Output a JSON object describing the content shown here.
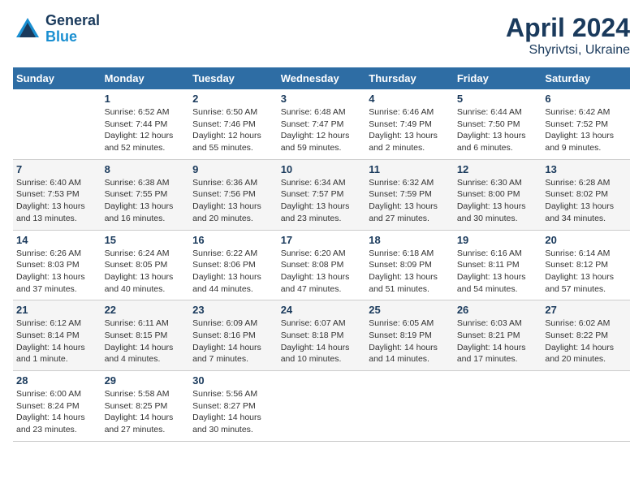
{
  "logo": {
    "name_part1": "General",
    "name_part2": "Blue"
  },
  "title": "April 2024",
  "subtitle": "Shyrivtsi, Ukraine",
  "header_days": [
    "Sunday",
    "Monday",
    "Tuesday",
    "Wednesday",
    "Thursday",
    "Friday",
    "Saturday"
  ],
  "weeks": [
    [
      {
        "day": "",
        "sunrise": "",
        "sunset": "",
        "daylight": ""
      },
      {
        "day": "1",
        "sunrise": "Sunrise: 6:52 AM",
        "sunset": "Sunset: 7:44 PM",
        "daylight": "Daylight: 12 hours and 52 minutes."
      },
      {
        "day": "2",
        "sunrise": "Sunrise: 6:50 AM",
        "sunset": "Sunset: 7:46 PM",
        "daylight": "Daylight: 12 hours and 55 minutes."
      },
      {
        "day": "3",
        "sunrise": "Sunrise: 6:48 AM",
        "sunset": "Sunset: 7:47 PM",
        "daylight": "Daylight: 12 hours and 59 minutes."
      },
      {
        "day": "4",
        "sunrise": "Sunrise: 6:46 AM",
        "sunset": "Sunset: 7:49 PM",
        "daylight": "Daylight: 13 hours and 2 minutes."
      },
      {
        "day": "5",
        "sunrise": "Sunrise: 6:44 AM",
        "sunset": "Sunset: 7:50 PM",
        "daylight": "Daylight: 13 hours and 6 minutes."
      },
      {
        "day": "6",
        "sunrise": "Sunrise: 6:42 AM",
        "sunset": "Sunset: 7:52 PM",
        "daylight": "Daylight: 13 hours and 9 minutes."
      }
    ],
    [
      {
        "day": "7",
        "sunrise": "Sunrise: 6:40 AM",
        "sunset": "Sunset: 7:53 PM",
        "daylight": "Daylight: 13 hours and 13 minutes."
      },
      {
        "day": "8",
        "sunrise": "Sunrise: 6:38 AM",
        "sunset": "Sunset: 7:55 PM",
        "daylight": "Daylight: 13 hours and 16 minutes."
      },
      {
        "day": "9",
        "sunrise": "Sunrise: 6:36 AM",
        "sunset": "Sunset: 7:56 PM",
        "daylight": "Daylight: 13 hours and 20 minutes."
      },
      {
        "day": "10",
        "sunrise": "Sunrise: 6:34 AM",
        "sunset": "Sunset: 7:57 PM",
        "daylight": "Daylight: 13 hours and 23 minutes."
      },
      {
        "day": "11",
        "sunrise": "Sunrise: 6:32 AM",
        "sunset": "Sunset: 7:59 PM",
        "daylight": "Daylight: 13 hours and 27 minutes."
      },
      {
        "day": "12",
        "sunrise": "Sunrise: 6:30 AM",
        "sunset": "Sunset: 8:00 PM",
        "daylight": "Daylight: 13 hours and 30 minutes."
      },
      {
        "day": "13",
        "sunrise": "Sunrise: 6:28 AM",
        "sunset": "Sunset: 8:02 PM",
        "daylight": "Daylight: 13 hours and 34 minutes."
      }
    ],
    [
      {
        "day": "14",
        "sunrise": "Sunrise: 6:26 AM",
        "sunset": "Sunset: 8:03 PM",
        "daylight": "Daylight: 13 hours and 37 minutes."
      },
      {
        "day": "15",
        "sunrise": "Sunrise: 6:24 AM",
        "sunset": "Sunset: 8:05 PM",
        "daylight": "Daylight: 13 hours and 40 minutes."
      },
      {
        "day": "16",
        "sunrise": "Sunrise: 6:22 AM",
        "sunset": "Sunset: 8:06 PM",
        "daylight": "Daylight: 13 hours and 44 minutes."
      },
      {
        "day": "17",
        "sunrise": "Sunrise: 6:20 AM",
        "sunset": "Sunset: 8:08 PM",
        "daylight": "Daylight: 13 hours and 47 minutes."
      },
      {
        "day": "18",
        "sunrise": "Sunrise: 6:18 AM",
        "sunset": "Sunset: 8:09 PM",
        "daylight": "Daylight: 13 hours and 51 minutes."
      },
      {
        "day": "19",
        "sunrise": "Sunrise: 6:16 AM",
        "sunset": "Sunset: 8:11 PM",
        "daylight": "Daylight: 13 hours and 54 minutes."
      },
      {
        "day": "20",
        "sunrise": "Sunrise: 6:14 AM",
        "sunset": "Sunset: 8:12 PM",
        "daylight": "Daylight: 13 hours and 57 minutes."
      }
    ],
    [
      {
        "day": "21",
        "sunrise": "Sunrise: 6:12 AM",
        "sunset": "Sunset: 8:14 PM",
        "daylight": "Daylight: 14 hours and 1 minute."
      },
      {
        "day": "22",
        "sunrise": "Sunrise: 6:11 AM",
        "sunset": "Sunset: 8:15 PM",
        "daylight": "Daylight: 14 hours and 4 minutes."
      },
      {
        "day": "23",
        "sunrise": "Sunrise: 6:09 AM",
        "sunset": "Sunset: 8:16 PM",
        "daylight": "Daylight: 14 hours and 7 minutes."
      },
      {
        "day": "24",
        "sunrise": "Sunrise: 6:07 AM",
        "sunset": "Sunset: 8:18 PM",
        "daylight": "Daylight: 14 hours and 10 minutes."
      },
      {
        "day": "25",
        "sunrise": "Sunrise: 6:05 AM",
        "sunset": "Sunset: 8:19 PM",
        "daylight": "Daylight: 14 hours and 14 minutes."
      },
      {
        "day": "26",
        "sunrise": "Sunrise: 6:03 AM",
        "sunset": "Sunset: 8:21 PM",
        "daylight": "Daylight: 14 hours and 17 minutes."
      },
      {
        "day": "27",
        "sunrise": "Sunrise: 6:02 AM",
        "sunset": "Sunset: 8:22 PM",
        "daylight": "Daylight: 14 hours and 20 minutes."
      }
    ],
    [
      {
        "day": "28",
        "sunrise": "Sunrise: 6:00 AM",
        "sunset": "Sunset: 8:24 PM",
        "daylight": "Daylight: 14 hours and 23 minutes."
      },
      {
        "day": "29",
        "sunrise": "Sunrise: 5:58 AM",
        "sunset": "Sunset: 8:25 PM",
        "daylight": "Daylight: 14 hours and 27 minutes."
      },
      {
        "day": "30",
        "sunrise": "Sunrise: 5:56 AM",
        "sunset": "Sunset: 8:27 PM",
        "daylight": "Daylight: 14 hours and 30 minutes."
      },
      {
        "day": "",
        "sunrise": "",
        "sunset": "",
        "daylight": ""
      },
      {
        "day": "",
        "sunrise": "",
        "sunset": "",
        "daylight": ""
      },
      {
        "day": "",
        "sunrise": "",
        "sunset": "",
        "daylight": ""
      },
      {
        "day": "",
        "sunrise": "",
        "sunset": "",
        "daylight": ""
      }
    ]
  ]
}
